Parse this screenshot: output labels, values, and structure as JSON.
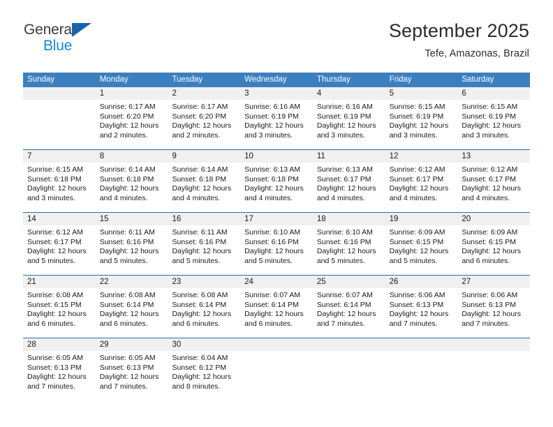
{
  "brand": {
    "name_top": "General",
    "name_bottom": "Blue",
    "accent_dark": "#1565a8",
    "accent_light": "#1a86d8"
  },
  "header": {
    "title": "September 2025",
    "subtitle": "Tefe, Amazonas, Brazil"
  },
  "calendar": {
    "header_bg": "#3c7fbf",
    "daynum_bg": "#f0f0f0",
    "weekdays": [
      "Sunday",
      "Monday",
      "Tuesday",
      "Wednesday",
      "Thursday",
      "Friday",
      "Saturday"
    ],
    "weeks": [
      {
        "days": [
          {
            "num": "",
            "lines": []
          },
          {
            "num": "1",
            "lines": [
              "Sunrise: 6:17 AM",
              "Sunset: 6:20 PM",
              "Daylight: 12 hours",
              "and 2 minutes."
            ]
          },
          {
            "num": "2",
            "lines": [
              "Sunrise: 6:17 AM",
              "Sunset: 6:20 PM",
              "Daylight: 12 hours",
              "and 2 minutes."
            ]
          },
          {
            "num": "3",
            "lines": [
              "Sunrise: 6:16 AM",
              "Sunset: 6:19 PM",
              "Daylight: 12 hours",
              "and 3 minutes."
            ]
          },
          {
            "num": "4",
            "lines": [
              "Sunrise: 6:16 AM",
              "Sunset: 6:19 PM",
              "Daylight: 12 hours",
              "and 3 minutes."
            ]
          },
          {
            "num": "5",
            "lines": [
              "Sunrise: 6:15 AM",
              "Sunset: 6:19 PM",
              "Daylight: 12 hours",
              "and 3 minutes."
            ]
          },
          {
            "num": "6",
            "lines": [
              "Sunrise: 6:15 AM",
              "Sunset: 6:19 PM",
              "Daylight: 12 hours",
              "and 3 minutes."
            ]
          }
        ]
      },
      {
        "days": [
          {
            "num": "7",
            "lines": [
              "Sunrise: 6:15 AM",
              "Sunset: 6:18 PM",
              "Daylight: 12 hours",
              "and 3 minutes."
            ]
          },
          {
            "num": "8",
            "lines": [
              "Sunrise: 6:14 AM",
              "Sunset: 6:18 PM",
              "Daylight: 12 hours",
              "and 4 minutes."
            ]
          },
          {
            "num": "9",
            "lines": [
              "Sunrise: 6:14 AM",
              "Sunset: 6:18 PM",
              "Daylight: 12 hours",
              "and 4 minutes."
            ]
          },
          {
            "num": "10",
            "lines": [
              "Sunrise: 6:13 AM",
              "Sunset: 6:18 PM",
              "Daylight: 12 hours",
              "and 4 minutes."
            ]
          },
          {
            "num": "11",
            "lines": [
              "Sunrise: 6:13 AM",
              "Sunset: 6:17 PM",
              "Daylight: 12 hours",
              "and 4 minutes."
            ]
          },
          {
            "num": "12",
            "lines": [
              "Sunrise: 6:12 AM",
              "Sunset: 6:17 PM",
              "Daylight: 12 hours",
              "and 4 minutes."
            ]
          },
          {
            "num": "13",
            "lines": [
              "Sunrise: 6:12 AM",
              "Sunset: 6:17 PM",
              "Daylight: 12 hours",
              "and 4 minutes."
            ]
          }
        ]
      },
      {
        "days": [
          {
            "num": "14",
            "lines": [
              "Sunrise: 6:12 AM",
              "Sunset: 6:17 PM",
              "Daylight: 12 hours",
              "and 5 minutes."
            ]
          },
          {
            "num": "15",
            "lines": [
              "Sunrise: 6:11 AM",
              "Sunset: 6:16 PM",
              "Daylight: 12 hours",
              "and 5 minutes."
            ]
          },
          {
            "num": "16",
            "lines": [
              "Sunrise: 6:11 AM",
              "Sunset: 6:16 PM",
              "Daylight: 12 hours",
              "and 5 minutes."
            ]
          },
          {
            "num": "17",
            "lines": [
              "Sunrise: 6:10 AM",
              "Sunset: 6:16 PM",
              "Daylight: 12 hours",
              "and 5 minutes."
            ]
          },
          {
            "num": "18",
            "lines": [
              "Sunrise: 6:10 AM",
              "Sunset: 6:16 PM",
              "Daylight: 12 hours",
              "and 5 minutes."
            ]
          },
          {
            "num": "19",
            "lines": [
              "Sunrise: 6:09 AM",
              "Sunset: 6:15 PM",
              "Daylight: 12 hours",
              "and 5 minutes."
            ]
          },
          {
            "num": "20",
            "lines": [
              "Sunrise: 6:09 AM",
              "Sunset: 6:15 PM",
              "Daylight: 12 hours",
              "and 6 minutes."
            ]
          }
        ]
      },
      {
        "days": [
          {
            "num": "21",
            "lines": [
              "Sunrise: 6:08 AM",
              "Sunset: 6:15 PM",
              "Daylight: 12 hours",
              "and 6 minutes."
            ]
          },
          {
            "num": "22",
            "lines": [
              "Sunrise: 6:08 AM",
              "Sunset: 6:14 PM",
              "Daylight: 12 hours",
              "and 6 minutes."
            ]
          },
          {
            "num": "23",
            "lines": [
              "Sunrise: 6:08 AM",
              "Sunset: 6:14 PM",
              "Daylight: 12 hours",
              "and 6 minutes."
            ]
          },
          {
            "num": "24",
            "lines": [
              "Sunrise: 6:07 AM",
              "Sunset: 6:14 PM",
              "Daylight: 12 hours",
              "and 6 minutes."
            ]
          },
          {
            "num": "25",
            "lines": [
              "Sunrise: 6:07 AM",
              "Sunset: 6:14 PM",
              "Daylight: 12 hours",
              "and 7 minutes."
            ]
          },
          {
            "num": "26",
            "lines": [
              "Sunrise: 6:06 AM",
              "Sunset: 6:13 PM",
              "Daylight: 12 hours",
              "and 7 minutes."
            ]
          },
          {
            "num": "27",
            "lines": [
              "Sunrise: 6:06 AM",
              "Sunset: 6:13 PM",
              "Daylight: 12 hours",
              "and 7 minutes."
            ]
          }
        ]
      },
      {
        "days": [
          {
            "num": "28",
            "lines": [
              "Sunrise: 6:05 AM",
              "Sunset: 6:13 PM",
              "Daylight: 12 hours",
              "and 7 minutes."
            ]
          },
          {
            "num": "29",
            "lines": [
              "Sunrise: 6:05 AM",
              "Sunset: 6:13 PM",
              "Daylight: 12 hours",
              "and 7 minutes."
            ]
          },
          {
            "num": "30",
            "lines": [
              "Sunrise: 6:04 AM",
              "Sunset: 6:12 PM",
              "Daylight: 12 hours",
              "and 8 minutes."
            ]
          },
          {
            "num": "",
            "lines": []
          },
          {
            "num": "",
            "lines": []
          },
          {
            "num": "",
            "lines": []
          },
          {
            "num": "",
            "lines": []
          }
        ]
      }
    ]
  }
}
